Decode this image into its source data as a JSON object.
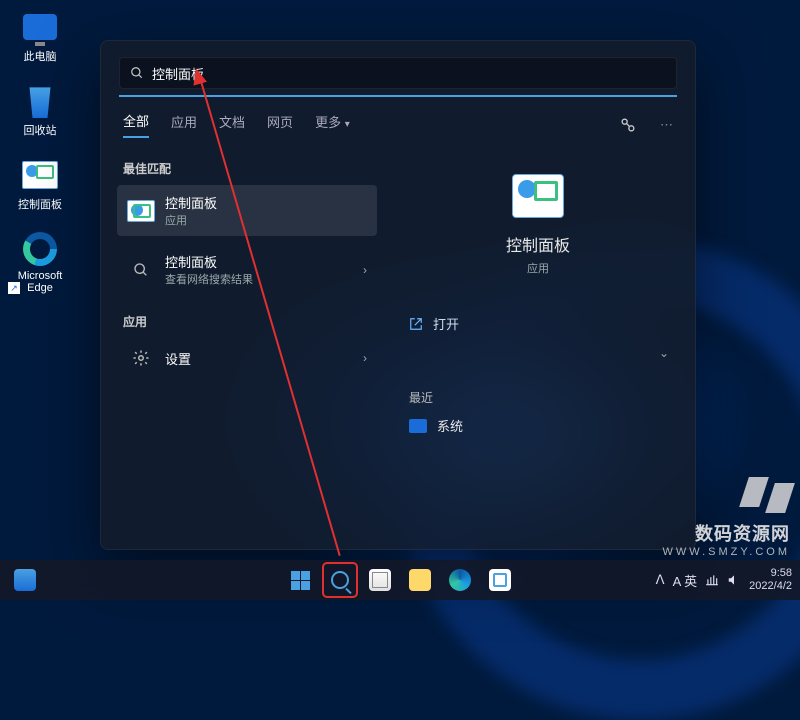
{
  "desktop": {
    "icons": [
      {
        "label": "此电脑"
      },
      {
        "label": "回收站"
      },
      {
        "label": "控制面板"
      },
      {
        "label": "Microsoft Edge"
      }
    ]
  },
  "search": {
    "query": "控制面板",
    "tabs": {
      "all": "全部",
      "apps": "应用",
      "docs": "文档",
      "web": "网页",
      "more": "更多"
    },
    "best_match_label": "最佳匹配",
    "apps_label": "应用",
    "results": {
      "cp": {
        "title": "控制面板",
        "sub": "应用"
      },
      "cp_web": {
        "title": "控制面板",
        "sub": "查看网络搜索结果"
      },
      "settings": {
        "title": "设置"
      }
    },
    "preview": {
      "title": "控制面板",
      "sub": "应用",
      "open": "打开",
      "recent_label": "最近",
      "recent_item": "系统"
    }
  },
  "taskbar": {
    "ime": "英",
    "time": "9:58",
    "date": "2022/4/2",
    "tray_chevron": "ᐱ"
  },
  "watermark": {
    "title": "数码资源网",
    "sub": "WWW.SMZY.COM"
  }
}
